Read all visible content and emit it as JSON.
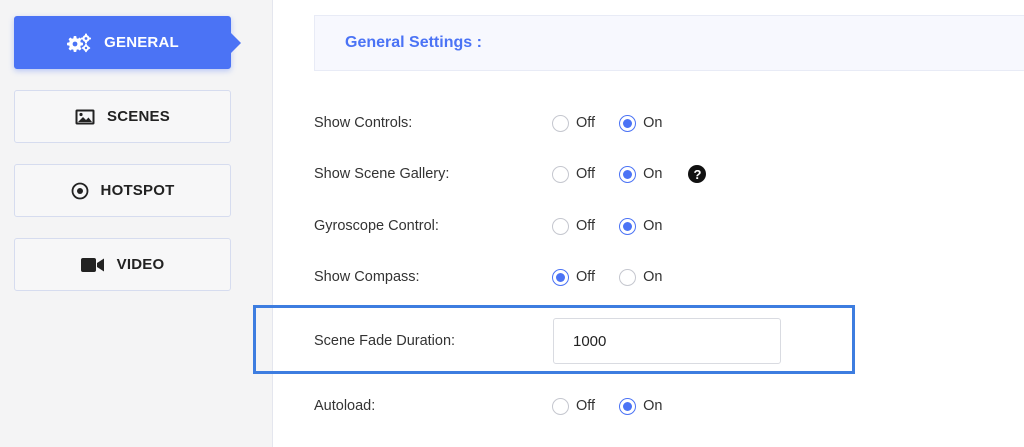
{
  "sidebar": {
    "items": [
      {
        "label": "GENERAL",
        "icon": "gears-icon",
        "active": true
      },
      {
        "label": "SCENES",
        "icon": "image-icon",
        "active": false
      },
      {
        "label": "HOTSPOT",
        "icon": "target-icon",
        "active": false
      },
      {
        "label": "VIDEO",
        "icon": "video-camera-icon",
        "active": false
      }
    ]
  },
  "main": {
    "title": "General Settings :",
    "accent_color": "#4b73f5",
    "settings": [
      {
        "label": "Show Controls:",
        "options": [
          "Off",
          "On"
        ],
        "selected": "On"
      },
      {
        "label": "Show Scene Gallery:",
        "options": [
          "Off",
          "On"
        ],
        "selected": "On",
        "help_icon": "question-circle-icon"
      },
      {
        "label": "Gyroscope Control:",
        "options": [
          "Off",
          "On"
        ],
        "selected": "On"
      },
      {
        "label": "Show Compass:",
        "options": [
          "Off",
          "On"
        ],
        "selected": "Off"
      },
      {
        "label": "Scene Fade Duration:",
        "value": "1000"
      },
      {
        "label": "Autoload:",
        "options": [
          "Off",
          "On"
        ],
        "selected": "On"
      }
    ]
  }
}
